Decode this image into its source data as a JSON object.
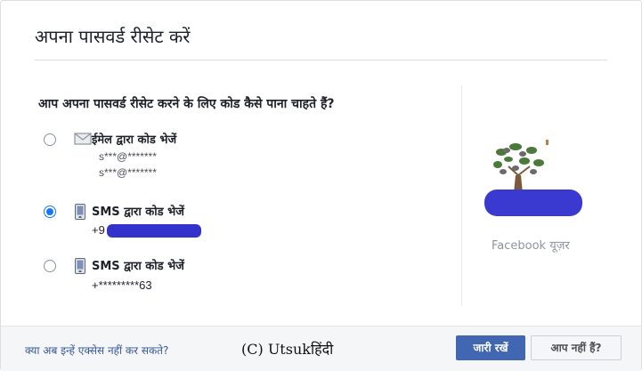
{
  "dialog": {
    "title": "अपना पासवर्ड रीसेट करें",
    "question": "आप अपना पासवर्ड रीसेट करने के लिए कोड कैसे पाना चाहते हैं?"
  },
  "options": [
    {
      "label": "ईमेल द्वारा कोड भेजें",
      "details": [
        "s***@*******",
        "s***@*******"
      ],
      "selected": false,
      "icon": "envelope-icon"
    },
    {
      "label": "SMS द्वारा कोड भेजें",
      "details": [
        "+9"
      ],
      "selected": true,
      "icon": "phone-icon"
    },
    {
      "label": "SMS द्वारा कोड भेजें",
      "details": [
        "+*********63"
      ],
      "selected": false,
      "icon": "phone-icon"
    }
  ],
  "profile": {
    "user_label": "Facebook यूज़र"
  },
  "footer": {
    "no_access_link": "क्या अब इन्हें एक्सेस नहीं कर सकते?",
    "watermark": "(C) Utsukहिंदी",
    "continue_button": "जारी रखें",
    "not_you_button": "आप नहीं हैं?"
  },
  "colors": {
    "primary": "#4267b2",
    "radio_checked": "#1877f2",
    "link": "#385898"
  }
}
